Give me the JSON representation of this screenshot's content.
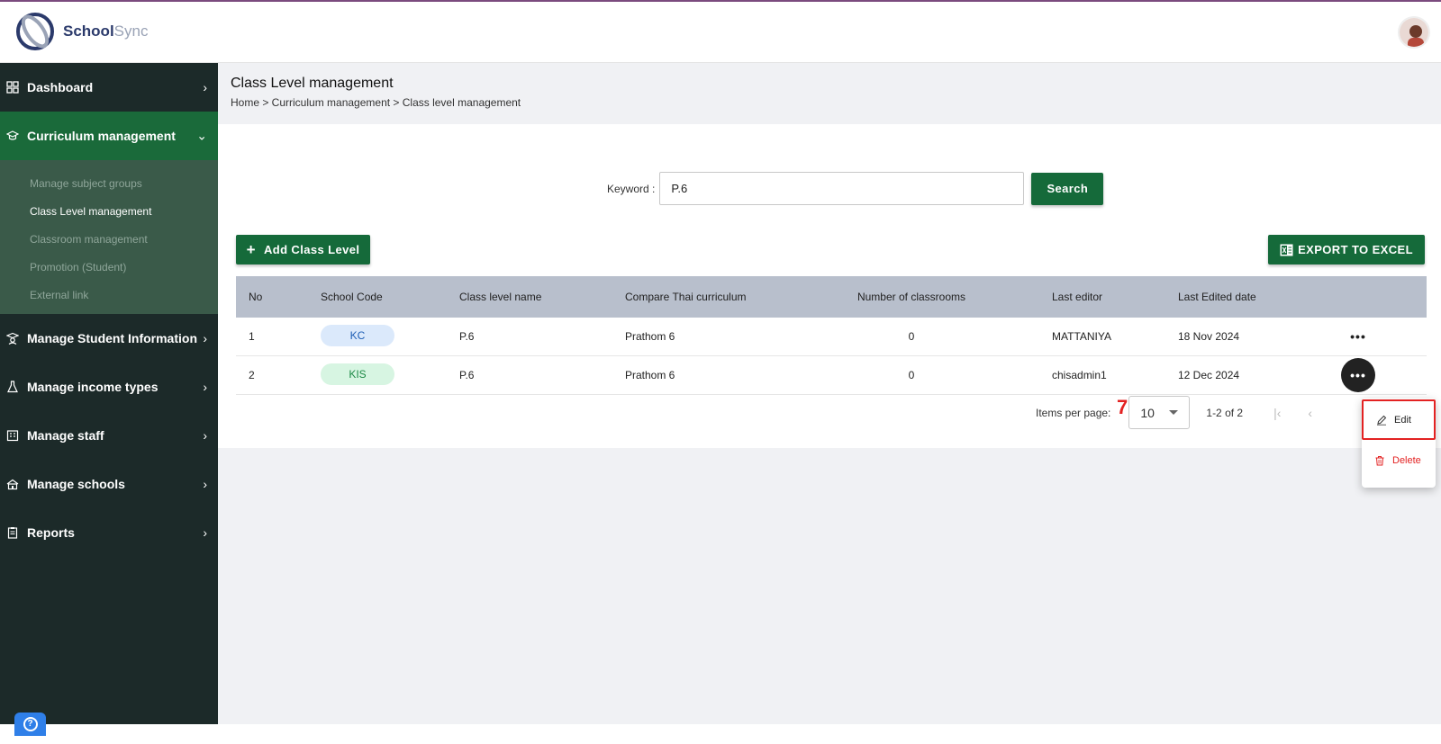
{
  "app": {
    "name_primary": "School",
    "name_secondary": "Sync"
  },
  "sidebar": {
    "items": [
      {
        "label": "Dashboard",
        "icon": "grid-icon"
      },
      {
        "label": "Curriculum management",
        "icon": "graduation-cap-icon",
        "expanded": true
      },
      {
        "label": "Manage Student Information",
        "icon": "student-icon"
      },
      {
        "label": "Manage income types",
        "icon": "flask-icon"
      },
      {
        "label": "Manage staff",
        "icon": "building-icon"
      },
      {
        "label": "Manage schools",
        "icon": "school-icon"
      },
      {
        "label": "Reports",
        "icon": "clipboard-icon"
      }
    ],
    "submenu": [
      {
        "label": "Manage subject groups"
      },
      {
        "label": "Class Level management",
        "current": true
      },
      {
        "label": "Classroom management"
      },
      {
        "label": "Promotion (Student)"
      },
      {
        "label": "External link"
      }
    ]
  },
  "page": {
    "title": "Class Level management",
    "breadcrumb": "Home > Curriculum management > Class level management"
  },
  "search": {
    "label": "Keyword :",
    "value": "P.6",
    "button": "Search"
  },
  "actions": {
    "add_label": "Add Class Level",
    "export_label": "EXPORT TO EXCEL"
  },
  "table": {
    "headers": [
      "No",
      "School Code",
      "Class level name",
      "Compare Thai curriculum",
      "Number of classrooms",
      "Last editor",
      "Last Edited date"
    ],
    "rows": [
      {
        "no": "1",
        "code": "KC",
        "name": "P.6",
        "thai": "Prathom 6",
        "classrooms": "0",
        "editor": "MATTANIYA",
        "date": "18 Nov 2024"
      },
      {
        "no": "2",
        "code": "KIS",
        "name": "P.6",
        "thai": "Prathom 6",
        "classrooms": "0",
        "editor": "chisadmin1",
        "date": "12 Dec 2024"
      }
    ],
    "more_label": "•••"
  },
  "pagination": {
    "items_per_page_label": "Items per page:",
    "items_per_page": "10",
    "range": "1-2 of 2"
  },
  "annotation": {
    "step": "7"
  },
  "row_menu": {
    "edit": "Edit",
    "delete": "Delete"
  },
  "help": {
    "glyph": "?"
  },
  "colors": {
    "sidebar_bg": "#1c2a29",
    "active_nav": "#1a6a3a",
    "primary_button": "#156a3a",
    "table_header": "#b8bfcc",
    "highlight_red": "#e32222"
  }
}
